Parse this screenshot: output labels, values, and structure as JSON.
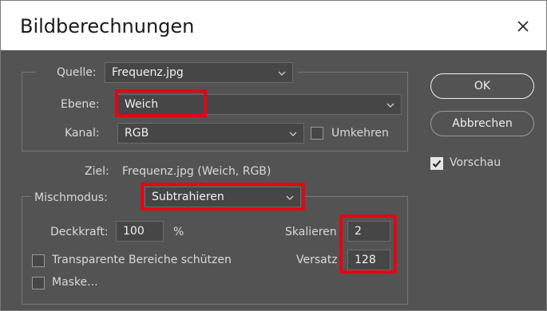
{
  "window": {
    "title": "Bildberechnungen"
  },
  "source": {
    "quelle_label": "Quelle:",
    "quelle_value": "Frequenz.jpg",
    "ebene_label": "Ebene:",
    "ebene_value": "Weich",
    "kanal_label": "Kanal:",
    "kanal_value": "RGB",
    "invert_label": "Umkehren",
    "invert_checked": false
  },
  "target": {
    "label": "Ziel:",
    "value": "Frequenz.jpg (Weich, RGB)"
  },
  "blending": {
    "mode_label": "Mischmodus:",
    "mode_value": "Subtrahieren",
    "opacity_label": "Deckkraft:",
    "opacity_value": "100",
    "opacity_unit": "%",
    "scale_label": "Skalieren",
    "scale_value": "2",
    "offset_label": "Versatz",
    "offset_value": "128",
    "preserve_transparency_label": "Transparente Bereiche schützen",
    "preserve_transparency_checked": false,
    "mask_label": "Maske...",
    "mask_checked": false
  },
  "buttons": {
    "ok": "OK",
    "cancel": "Abbrechen"
  },
  "preview": {
    "label": "Vorschau",
    "checked": true
  },
  "colors": {
    "highlight": "#e30613",
    "dialog_bg": "#535353",
    "field_bg": "#464646"
  }
}
